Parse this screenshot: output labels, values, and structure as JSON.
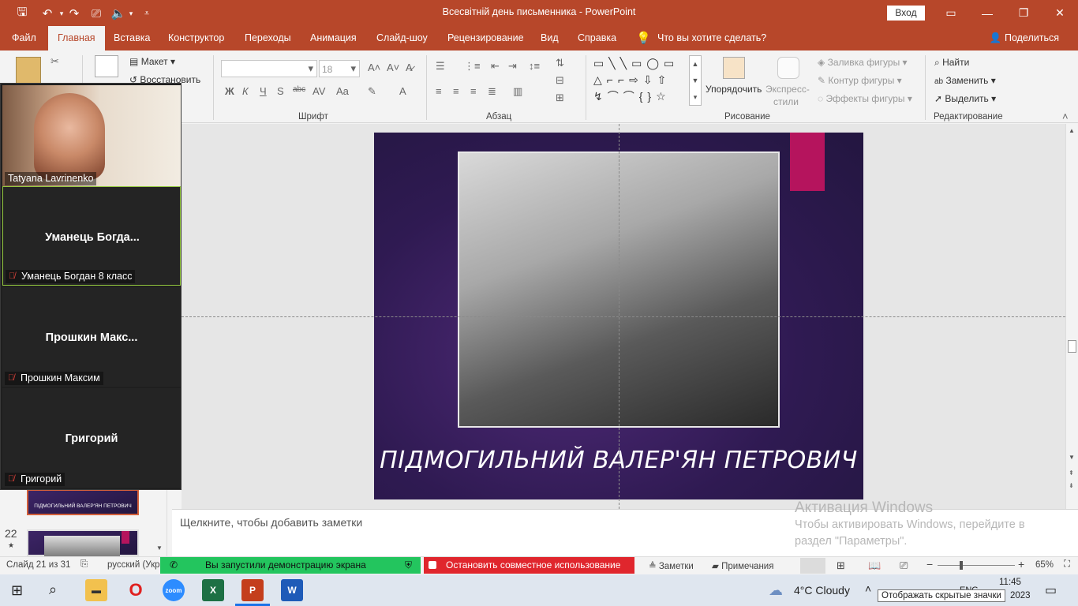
{
  "window": {
    "title": "Всесвітній день письменника  -  PowerPoint",
    "signin_label": "Вход"
  },
  "menu": {
    "tabs": [
      "Файл",
      "Главная",
      "Вставка",
      "Конструктор",
      "Переходы",
      "Анимация",
      "Слайд-шоу",
      "Рецензирование",
      "Вид",
      "Справка"
    ],
    "active_tab": "Главная",
    "tell_me": "Что вы хотите сделать?",
    "share": "Поделиться"
  },
  "ribbon": {
    "slides": {
      "layout": "Макет",
      "reset": "Восстановить"
    },
    "font": {
      "size": "18",
      "label": "Шрифт"
    },
    "paragraph": {
      "label": "Абзац"
    },
    "drawing": {
      "arrange": "Упорядочить",
      "quick_styles": "Экспресс-",
      "quick_styles2": "стили",
      "fill": "Заливка фигуры",
      "outline": "Контур фигуры",
      "effects": "Эффекты фигуры",
      "label": "Рисование"
    },
    "editing": {
      "find": "Найти",
      "replace": "Заменить",
      "select": "Выделить",
      "label": "Редактирование"
    }
  },
  "slide": {
    "caption": "ПІДМОГИЛЬНИЙ ВАЛЕР'ЯН ПЕТРОВИЧ",
    "thumb_caption": "ПІДМОГИЛЬНИЙ ВАЛЕР'ЯН ПЕТРОВИЧ",
    "next_number": "22",
    "next_star": "★"
  },
  "notes": {
    "placeholder": "Щелкните, чтобы добавить заметки"
  },
  "activation": {
    "title": "Активация Windows",
    "line1": "Чтобы активировать Windows, перейдите в",
    "line2": "раздел \"Параметры\"."
  },
  "zoom": {
    "participants": [
      {
        "name": "Tatyana Lavrinenko",
        "big": ""
      },
      {
        "name": "Уманець Богдан 8 класс",
        "big": "Уманець  Богда..."
      },
      {
        "name": "Прошкин Максим",
        "big": "Прошкин  Макс..."
      },
      {
        "name": "Григорий",
        "big": "Григорий"
      }
    ],
    "sharing_msg": "Вы запустили демонстрацию экрана",
    "stop_msg": "Остановить совместное использование"
  },
  "statusbar": {
    "slide_info": "Слайд 21 из 31",
    "language": "русский (Укр",
    "notes": "Заметки",
    "comments": "Примечания",
    "zoom": "65%"
  },
  "taskbar": {
    "weather": "4°C  Cloudy",
    "time": "11:45",
    "date": "2023",
    "lang": "ENG",
    "tooltip": "Отображать скрытые значки"
  },
  "colors": {
    "accent": "#b7472a",
    "slide_bg": "#2f1a52",
    "slide_accent": "#b5145d",
    "zoom_green": "#23c55e",
    "zoom_red": "#e0262d"
  }
}
